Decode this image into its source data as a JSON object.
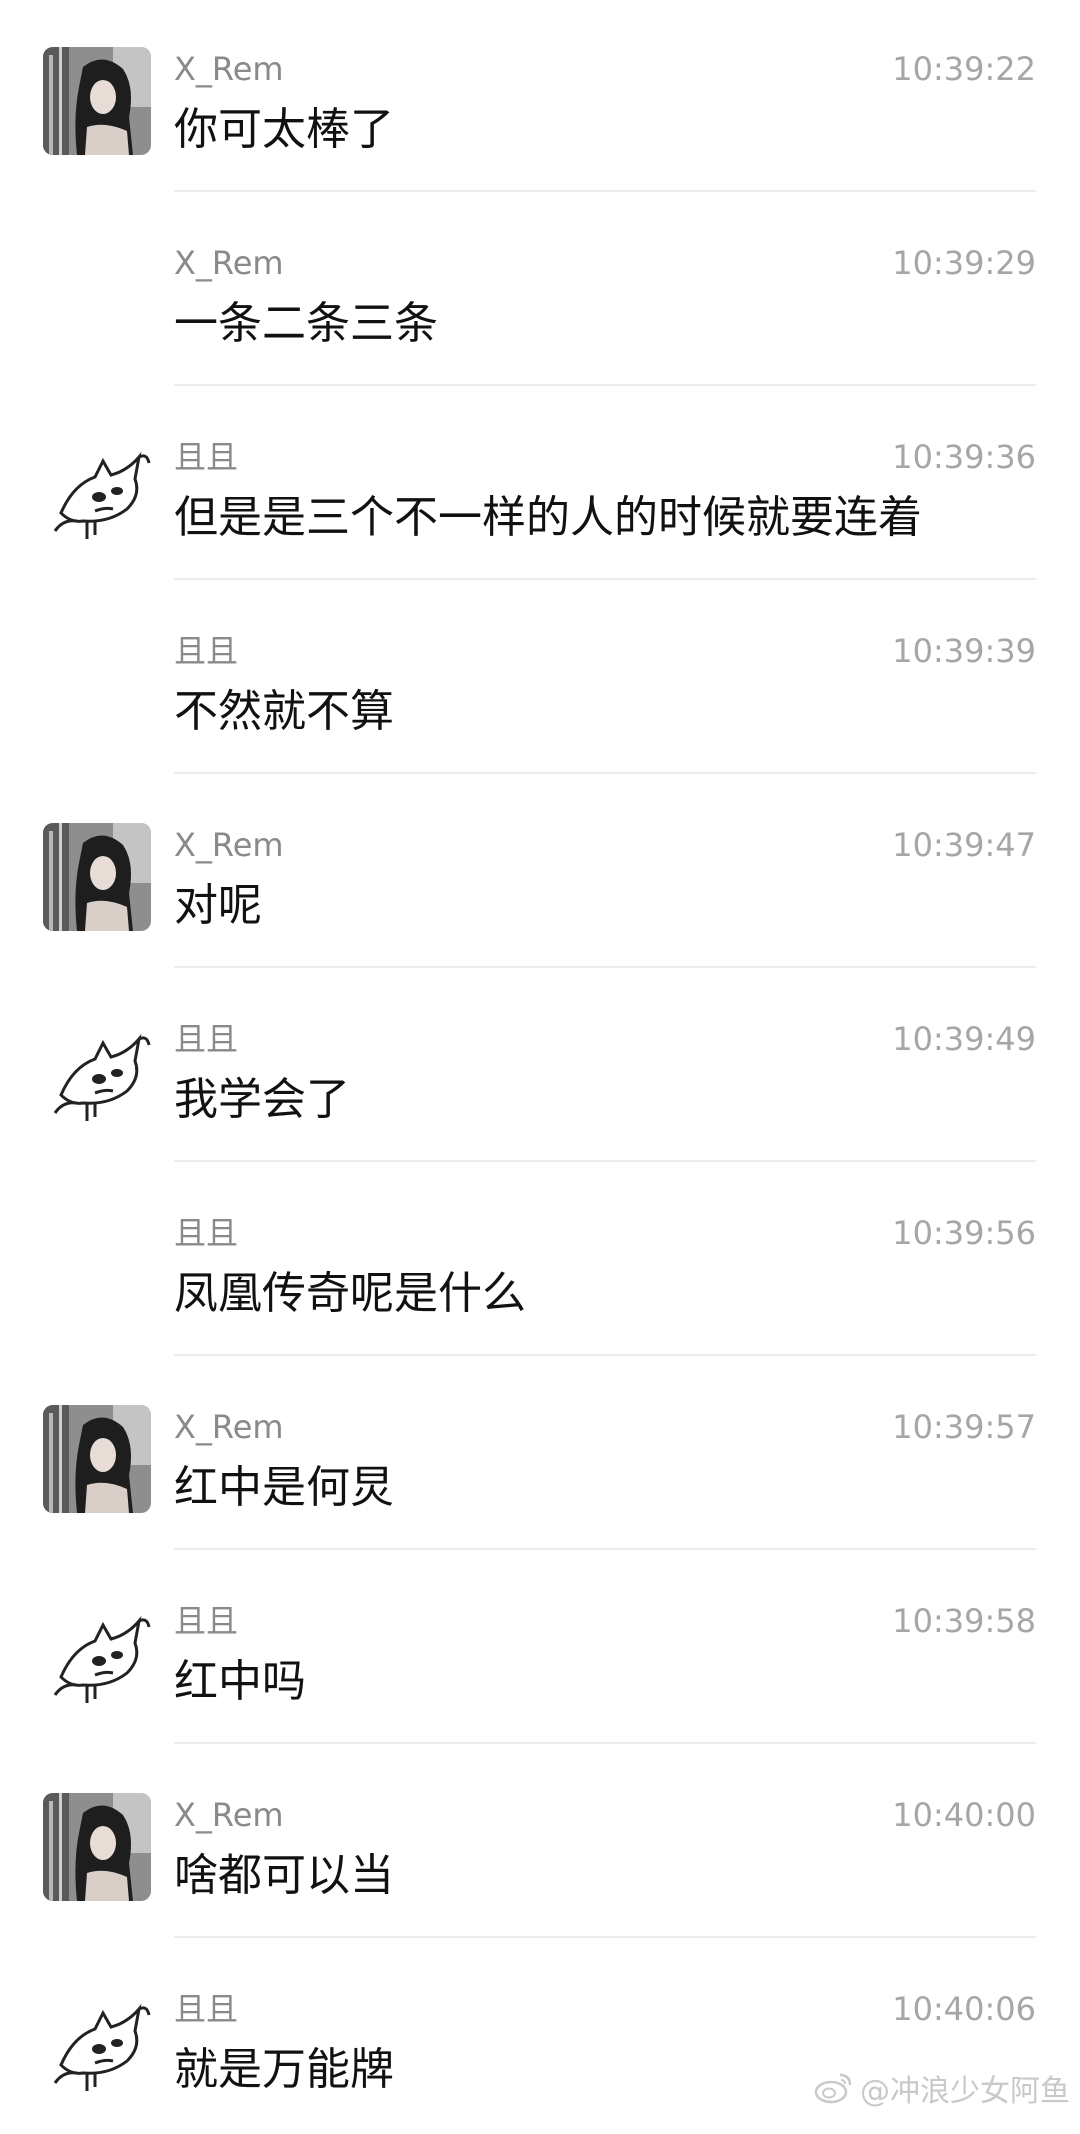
{
  "messages": [
    {
      "sender": "X_Rem",
      "time": "10:39:22",
      "text": "你可太棒了",
      "avatar": "girl-photo"
    },
    {
      "sender": "X_Rem",
      "time": "10:39:29",
      "text": "一条二条三条",
      "avatar": ""
    },
    {
      "sender": "且且",
      "time": "10:39:36",
      "text": "但是是三个不一样的人的时候就要连着",
      "avatar": "cat-doodle"
    },
    {
      "sender": "且且",
      "time": "10:39:39",
      "text": "不然就不算",
      "avatar": ""
    },
    {
      "sender": "X_Rem",
      "time": "10:39:47",
      "text": "对呢",
      "avatar": "girl-photo"
    },
    {
      "sender": "且且",
      "time": "10:39:49",
      "text": "我学会了",
      "avatar": "cat-doodle"
    },
    {
      "sender": "且且",
      "time": "10:39:56",
      "text": "凤凰传奇呢是什么",
      "avatar": ""
    },
    {
      "sender": "X_Rem",
      "time": "10:39:57",
      "text": "红中是何炅",
      "avatar": "girl-photo"
    },
    {
      "sender": "且且",
      "time": "10:39:58",
      "text": "红中吗",
      "avatar": "cat-doodle"
    },
    {
      "sender": "X_Rem",
      "time": "10:40:00",
      "text": "啥都可以当",
      "avatar": "girl-photo"
    },
    {
      "sender": "且且",
      "time": "10:40:06",
      "text": "就是万能牌",
      "avatar": "cat-doodle"
    }
  ],
  "watermark": {
    "icon": "weibo-icon",
    "text": "@冲浪少女阿鱼"
  }
}
